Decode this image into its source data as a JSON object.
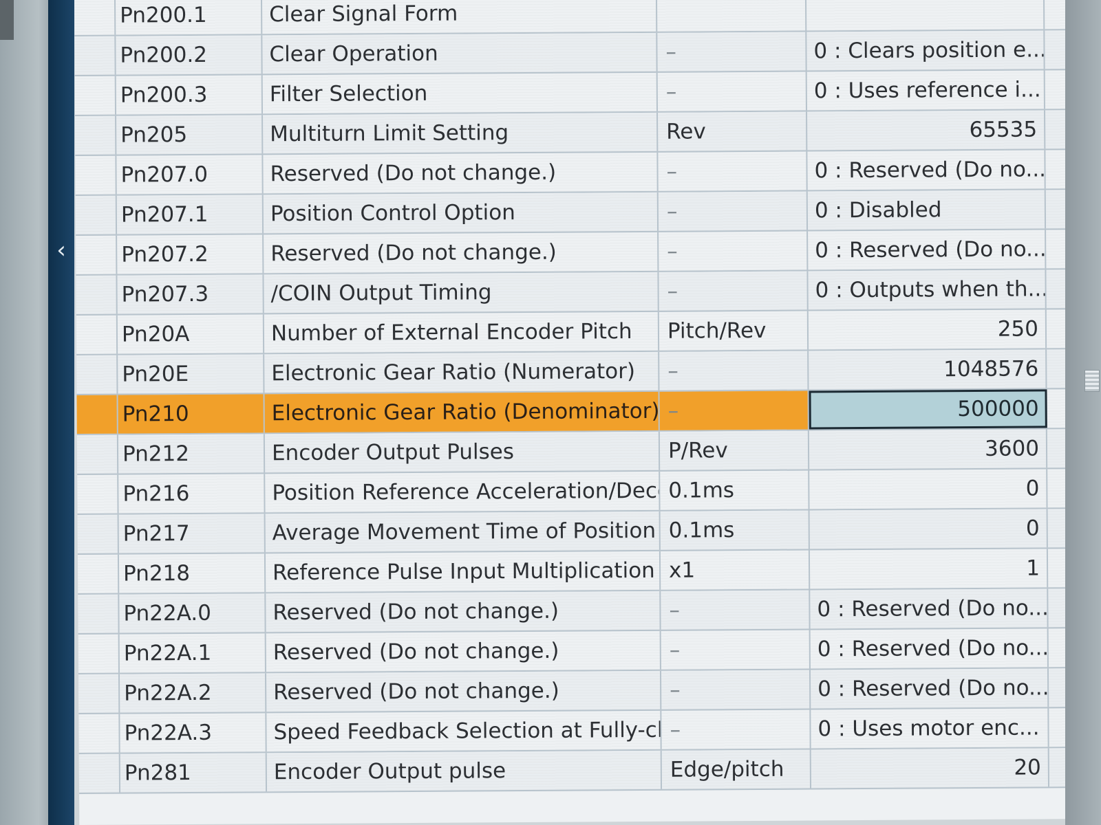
{
  "navigation": {
    "collapse_glyph": "‹"
  },
  "table": {
    "rows": [
      {
        "no": "Pn200.1",
        "name": "Clear Signal Form",
        "unit": "",
        "value": "",
        "selected": false
      },
      {
        "no": "Pn200.2",
        "name": "Clear Operation",
        "unit": "–",
        "value": "0 : Clears position e...",
        "selected": false
      },
      {
        "no": "Pn200.3",
        "name": "Filter Selection",
        "unit": "–",
        "value": "0 : Uses reference i...",
        "selected": false
      },
      {
        "no": "Pn205",
        "name": "Multiturn Limit Setting",
        "unit": "Rev",
        "value": "65535",
        "selected": false
      },
      {
        "no": "Pn207.0",
        "name": "Reserved (Do not change.)",
        "unit": "–",
        "value": "0 : Reserved (Do no...",
        "selected": false
      },
      {
        "no": "Pn207.1",
        "name": "Position Control Option",
        "unit": "–",
        "value": "0 : Disabled",
        "selected": false
      },
      {
        "no": "Pn207.2",
        "name": "Reserved (Do not change.)",
        "unit": "–",
        "value": "0 : Reserved (Do no...",
        "selected": false
      },
      {
        "no": "Pn207.3",
        "name": "/COIN Output Timing",
        "unit": "–",
        "value": "0 : Outputs when th...",
        "selected": false
      },
      {
        "no": "Pn20A",
        "name": "Number of External Encoder Pitch",
        "unit": "Pitch/Rev",
        "value": "250",
        "selected": false
      },
      {
        "no": "Pn20E",
        "name": "Electronic Gear Ratio (Numerator)",
        "unit": "–",
        "value": "1048576",
        "selected": false
      },
      {
        "no": "Pn210",
        "name": "Electronic Gear Ratio (Denominator)",
        "unit": "–",
        "value": "500000",
        "selected": true
      },
      {
        "no": "Pn212",
        "name": "Encoder Output Pulses",
        "unit": "P/Rev",
        "value": "3600",
        "selected": false
      },
      {
        "no": "Pn216",
        "name": "Position Reference Acceleration/Decele",
        "unit": "0.1ms",
        "value": "0",
        "selected": false
      },
      {
        "no": "Pn217",
        "name": "Average Movement Time of Position Re",
        "unit": "0.1ms",
        "value": "0",
        "selected": false
      },
      {
        "no": "Pn218",
        "name": "Reference Pulse Input Multiplication",
        "unit": "x1",
        "value": "1",
        "selected": false
      },
      {
        "no": "Pn22A.0",
        "name": "Reserved (Do not change.)",
        "unit": "–",
        "value": "0 : Reserved (Do no...",
        "selected": false
      },
      {
        "no": "Pn22A.1",
        "name": "Reserved (Do not change.)",
        "unit": "–",
        "value": "0 : Reserved (Do no...",
        "selected": false
      },
      {
        "no": "Pn22A.2",
        "name": "Reserved (Do not change.)",
        "unit": "–",
        "value": "0 : Reserved (Do no...",
        "selected": false
      },
      {
        "no": "Pn22A.3",
        "name": "Speed Feedback Selection at Fully-clos",
        "unit": "–",
        "value": "0 : Uses motor enc...",
        "selected": false
      },
      {
        "no": "Pn281",
        "name": "Encoder Output pulse",
        "unit": "Edge/pitch",
        "value": "20",
        "selected": false
      }
    ]
  },
  "colors": {
    "selected_row": "#f1a02a",
    "selected_value_cell": "#b3d1d8",
    "grid_line": "#b7c3cc",
    "left_strip": "#163c5c"
  }
}
